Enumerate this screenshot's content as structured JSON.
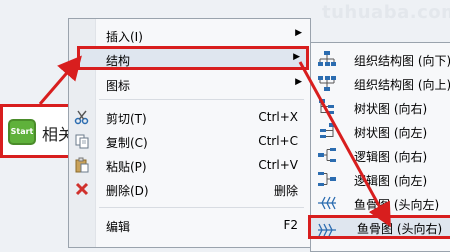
{
  "watermark": "tuhuaba.com",
  "node": {
    "start_label": "Start",
    "text": "相关"
  },
  "context_menu": {
    "items": [
      {
        "label": "插入(I)",
        "shortcut": "",
        "submenu": true
      },
      {
        "label": "结构",
        "shortcut": "",
        "submenu": true,
        "highlighted": true
      },
      {
        "label": "图标",
        "shortcut": "",
        "submenu": true
      },
      {
        "label": "剪切(T)",
        "shortcut": "Ctrl+X",
        "icon": "scissors-icon"
      },
      {
        "label": "复制(C)",
        "shortcut": "Ctrl+C",
        "icon": "copy-icon"
      },
      {
        "label": "粘贴(P)",
        "shortcut": "Ctrl+V",
        "icon": "paste-icon"
      },
      {
        "label": "删除(D)",
        "shortcut": "删除",
        "icon": "delete-icon"
      },
      {
        "label": "编辑",
        "shortcut": "F2"
      }
    ]
  },
  "structure_submenu": {
    "items": [
      {
        "label": "组织结构图 (向下)",
        "icon": "org-down-icon"
      },
      {
        "label": "组织结构图 (向上)",
        "icon": "org-up-icon"
      },
      {
        "label": "树状图 (向右)",
        "icon": "tree-right-icon"
      },
      {
        "label": "树状图 (向左)",
        "icon": "tree-left-icon"
      },
      {
        "label": "逻辑图 (向右)",
        "icon": "logic-right-icon"
      },
      {
        "label": "逻辑图 (向左)",
        "icon": "logic-left-icon"
      },
      {
        "label": "鱼骨图 (头向左)",
        "icon": "fishbone-left-icon"
      },
      {
        "label": "鱼骨图 (头向右)",
        "icon": "fishbone-right-icon",
        "highlighted": true
      }
    ]
  },
  "colors": {
    "highlight_border": "#d81e1e",
    "menu_bg": "#f7f8fa",
    "icon_blue": "#2b6cb0"
  }
}
